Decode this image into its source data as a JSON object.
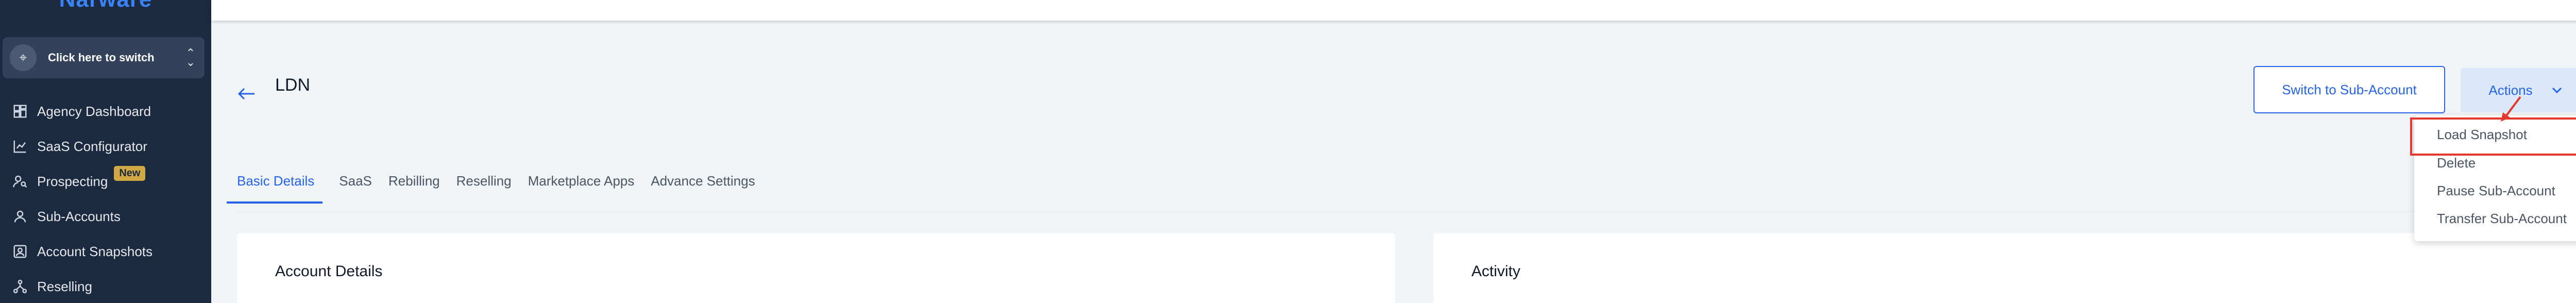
{
  "brand": {
    "name": "Narware"
  },
  "switcher": {
    "label": "Click here to switch"
  },
  "sidebar": {
    "items": [
      {
        "label": "Agency Dashboard",
        "icon": "dashboard-icon"
      },
      {
        "label": "SaaS Configurator",
        "icon": "chart-icon"
      },
      {
        "label": "Prospecting",
        "icon": "users-search-icon",
        "badge": "New"
      },
      {
        "label": "Sub-Accounts",
        "icon": "user-icon"
      },
      {
        "label": "Account Snapshots",
        "icon": "snapshot-icon"
      },
      {
        "label": "Reselling",
        "icon": "network-icon"
      }
    ]
  },
  "header": {
    "title": "LDN",
    "switch_button": "Switch to Sub-Account",
    "actions_button": "Actions"
  },
  "tabs": [
    {
      "label": "Basic Details",
      "active": true
    },
    {
      "label": "SaaS"
    },
    {
      "label": "Rebilling"
    },
    {
      "label": "Reselling"
    },
    {
      "label": "Marketplace Apps"
    },
    {
      "label": "Advance Settings"
    }
  ],
  "cards": {
    "account": "Account Details",
    "activity": "Activity"
  },
  "actions_menu": {
    "items": [
      "Load Snapshot",
      "Delete",
      "Pause Sub-Account",
      "Transfer Sub-Account"
    ]
  },
  "colors": {
    "sidebar_bg": "#1c2a3f",
    "accent": "#2563eb",
    "annotation": "#e23b2e",
    "badge": "#d1a843"
  }
}
